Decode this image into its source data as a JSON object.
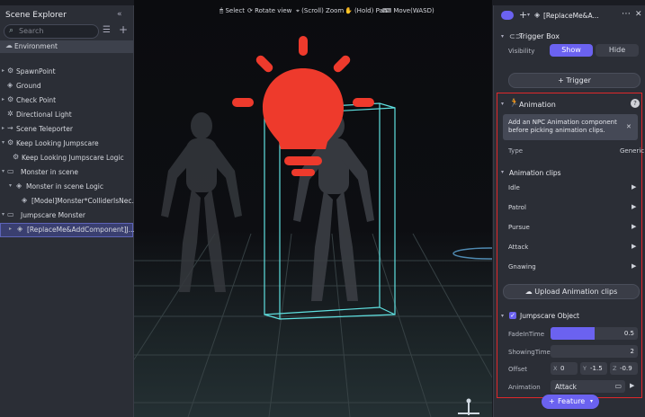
{
  "scene_explorer": {
    "title": "Scene Explorer",
    "search_placeholder": "Search",
    "items": [
      {
        "label": "Environment"
      },
      {
        "label": "SpawnPoint"
      },
      {
        "label": "Ground"
      },
      {
        "label": "Check Point"
      },
      {
        "label": "Directional Light"
      },
      {
        "label": "Scene Teleporter"
      },
      {
        "label": "Keep Looking Jumpscare"
      },
      {
        "label": "Keep Looking Jumpscare Logic"
      },
      {
        "label": "Monster in scene"
      },
      {
        "label": "Monster in scene Logic"
      },
      {
        "label": "[Model]Monster*ColliderIsNec..."
      },
      {
        "label": "Jumpscare Monster"
      },
      {
        "label": "[ReplaceMe&AddComponent]J..."
      }
    ]
  },
  "viewport_toolbar": {
    "select": "Select",
    "rotate": "Rotate view",
    "zoom": "(Scroll) Zoom",
    "pan": "(Hold) Pan",
    "move": "Move(WASD)"
  },
  "inspector": {
    "object_name": "[ReplaceMe&A...",
    "trigger_box": {
      "title": "Trigger Box",
      "visibility_label": "Visibility",
      "show": "Show",
      "hide": "Hide",
      "trigger_button": "Trigger"
    },
    "animation": {
      "title": "Animation",
      "notice": "Add an NPC Animation component before picking animation clips.",
      "type_label": "Type",
      "type_value": "Generic",
      "clips_title": "Animation clips",
      "clips": [
        "Idle",
        "Patrol",
        "Pursue",
        "Attack",
        "Gnawing"
      ],
      "upload_button": "Upload Animation clips"
    },
    "jumpscare": {
      "title": "Jumpscare Object",
      "fade_label": "FadeInTime",
      "fade_value": "0.5",
      "fade_fill": 0.5,
      "showing_label": "ShowingTime",
      "showing_value": "2",
      "offset_label": "Offset",
      "offset_x_label": "X",
      "offset_x": "0",
      "offset_y_label": "Y",
      "offset_y": "-1.5",
      "offset_z_label": "Z",
      "offset_z": "-0.9",
      "animation_label": "Animation",
      "animation_value": "Attack"
    },
    "feature_button": "Feature"
  },
  "colors": {
    "accent": "#6b62f0",
    "highlight_red": "#e0282a",
    "bulb_red": "#ee3a2c",
    "bbox_cyan": "#5fe0e0"
  }
}
